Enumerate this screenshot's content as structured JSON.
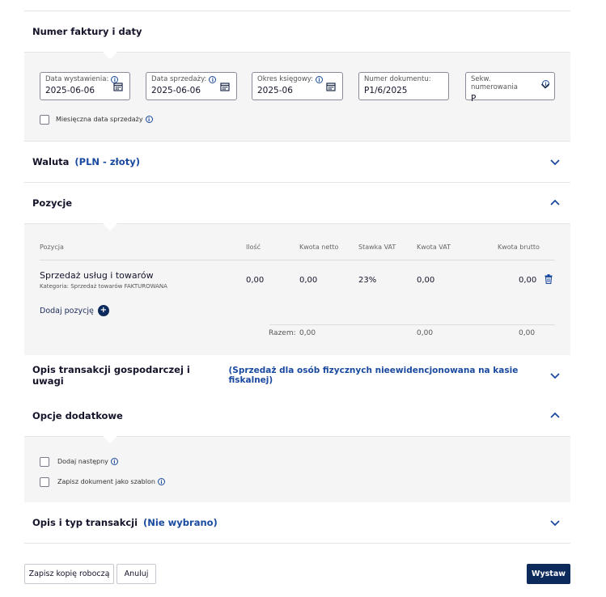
{
  "invoice": {
    "title": "Numer faktury i daty",
    "issue_date_label": "Data wystawienia:",
    "issue_date": "2025-06-06",
    "sale_date_label": "Data sprzedaży:",
    "sale_date": "2025-06-06",
    "period_label": "Okres księgowy:",
    "period": "2025-06",
    "doc_number_label": "Numer dokumentu:",
    "doc_number": "P1/6/2025",
    "sequence_label": "Sekw. numerowania",
    "sequence": "P",
    "monthly_label": "Miesięczna data sprzedaży"
  },
  "currency": {
    "title": "Waluta",
    "value": "(PLN - złoty)"
  },
  "positions": {
    "title": "Pozycje",
    "headers": [
      "Pozycja",
      "Ilość",
      "Kwota netto",
      "Stawka VAT",
      "Kwota VAT",
      "Kwota brutto"
    ],
    "row": {
      "name": "Sprzedaż usług i towarów",
      "category": "Kategoria: Sprzedaż towarów FAKTUROWANA",
      "qty": "0,00",
      "net": "0,00",
      "vat_rate": "23%",
      "vat": "0,00",
      "gross": "0,00"
    },
    "add_label": "Dodaj pozycję",
    "total_label": "Razem:",
    "total_net": "0,00",
    "total_vat": "0,00",
    "total_gross": "0,00"
  },
  "transaction_desc": {
    "title": "Opis transakcji gospodarczej i uwagi",
    "value": "(Sprzedaż dla osób fizycznych nieewidencjonowana na kasie fiskalnej)"
  },
  "options": {
    "title": "Opcje dodatkowe",
    "add_next": "Dodaj następny",
    "save_template": "Zapisz dokument jako szablon"
  },
  "transaction_type": {
    "title": "Opis i typ transakcji",
    "value": "(Nie wybrano)"
  },
  "footer": {
    "draft": "Zapisz kopię roboczą",
    "cancel": "Anuluj",
    "issue": "Wystaw"
  },
  "icons": {
    "info": "i"
  },
  "colors": {
    "accent": "#1a4aa0",
    "primary_button": "#0c2a5c"
  }
}
